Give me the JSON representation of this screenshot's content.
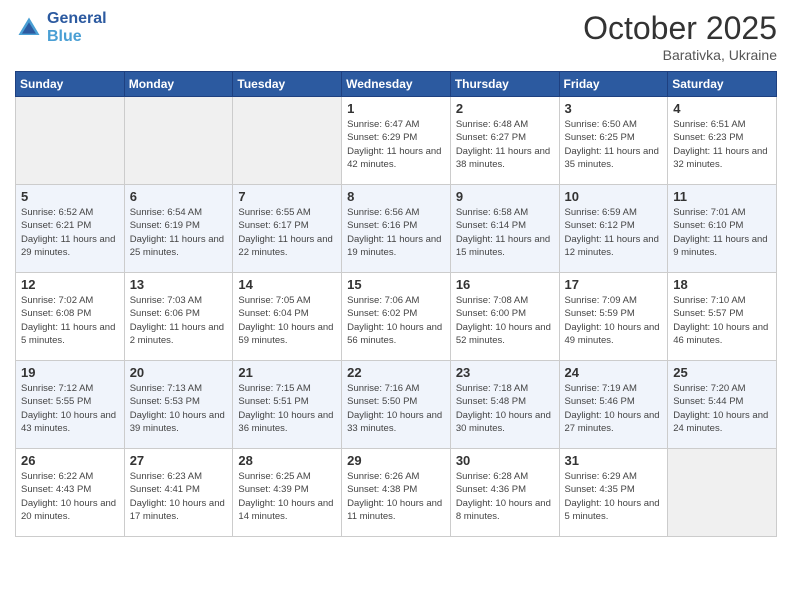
{
  "header": {
    "logo_line1": "General",
    "logo_line2": "Blue",
    "title": "October 2025",
    "subtitle": "Barativka, Ukraine"
  },
  "weekdays": [
    "Sunday",
    "Monday",
    "Tuesday",
    "Wednesday",
    "Thursday",
    "Friday",
    "Saturday"
  ],
  "weeks": [
    [
      {
        "day": "",
        "empty": true
      },
      {
        "day": "",
        "empty": true
      },
      {
        "day": "",
        "empty": true
      },
      {
        "day": "1",
        "sunrise": "6:47 AM",
        "sunset": "6:29 PM",
        "daylight": "11 hours and 42 minutes."
      },
      {
        "day": "2",
        "sunrise": "6:48 AM",
        "sunset": "6:27 PM",
        "daylight": "11 hours and 38 minutes."
      },
      {
        "day": "3",
        "sunrise": "6:50 AM",
        "sunset": "6:25 PM",
        "daylight": "11 hours and 35 minutes."
      },
      {
        "day": "4",
        "sunrise": "6:51 AM",
        "sunset": "6:23 PM",
        "daylight": "11 hours and 32 minutes."
      }
    ],
    [
      {
        "day": "5",
        "sunrise": "6:52 AM",
        "sunset": "6:21 PM",
        "daylight": "11 hours and 29 minutes."
      },
      {
        "day": "6",
        "sunrise": "6:54 AM",
        "sunset": "6:19 PM",
        "daylight": "11 hours and 25 minutes."
      },
      {
        "day": "7",
        "sunrise": "6:55 AM",
        "sunset": "6:17 PM",
        "daylight": "11 hours and 22 minutes."
      },
      {
        "day": "8",
        "sunrise": "6:56 AM",
        "sunset": "6:16 PM",
        "daylight": "11 hours and 19 minutes."
      },
      {
        "day": "9",
        "sunrise": "6:58 AM",
        "sunset": "6:14 PM",
        "daylight": "11 hours and 15 minutes."
      },
      {
        "day": "10",
        "sunrise": "6:59 AM",
        "sunset": "6:12 PM",
        "daylight": "11 hours and 12 minutes."
      },
      {
        "day": "11",
        "sunrise": "7:01 AM",
        "sunset": "6:10 PM",
        "daylight": "11 hours and 9 minutes."
      }
    ],
    [
      {
        "day": "12",
        "sunrise": "7:02 AM",
        "sunset": "6:08 PM",
        "daylight": "11 hours and 5 minutes."
      },
      {
        "day": "13",
        "sunrise": "7:03 AM",
        "sunset": "6:06 PM",
        "daylight": "11 hours and 2 minutes."
      },
      {
        "day": "14",
        "sunrise": "7:05 AM",
        "sunset": "6:04 PM",
        "daylight": "10 hours and 59 minutes."
      },
      {
        "day": "15",
        "sunrise": "7:06 AM",
        "sunset": "6:02 PM",
        "daylight": "10 hours and 56 minutes."
      },
      {
        "day": "16",
        "sunrise": "7:08 AM",
        "sunset": "6:00 PM",
        "daylight": "10 hours and 52 minutes."
      },
      {
        "day": "17",
        "sunrise": "7:09 AM",
        "sunset": "5:59 PM",
        "daylight": "10 hours and 49 minutes."
      },
      {
        "day": "18",
        "sunrise": "7:10 AM",
        "sunset": "5:57 PM",
        "daylight": "10 hours and 46 minutes."
      }
    ],
    [
      {
        "day": "19",
        "sunrise": "7:12 AM",
        "sunset": "5:55 PM",
        "daylight": "10 hours and 43 minutes."
      },
      {
        "day": "20",
        "sunrise": "7:13 AM",
        "sunset": "5:53 PM",
        "daylight": "10 hours and 39 minutes."
      },
      {
        "day": "21",
        "sunrise": "7:15 AM",
        "sunset": "5:51 PM",
        "daylight": "10 hours and 36 minutes."
      },
      {
        "day": "22",
        "sunrise": "7:16 AM",
        "sunset": "5:50 PM",
        "daylight": "10 hours and 33 minutes."
      },
      {
        "day": "23",
        "sunrise": "7:18 AM",
        "sunset": "5:48 PM",
        "daylight": "10 hours and 30 minutes."
      },
      {
        "day": "24",
        "sunrise": "7:19 AM",
        "sunset": "5:46 PM",
        "daylight": "10 hours and 27 minutes."
      },
      {
        "day": "25",
        "sunrise": "7:20 AM",
        "sunset": "5:44 PM",
        "daylight": "10 hours and 24 minutes."
      }
    ],
    [
      {
        "day": "26",
        "sunrise": "6:22 AM",
        "sunset": "4:43 PM",
        "daylight": "10 hours and 20 minutes."
      },
      {
        "day": "27",
        "sunrise": "6:23 AM",
        "sunset": "4:41 PM",
        "daylight": "10 hours and 17 minutes."
      },
      {
        "day": "28",
        "sunrise": "6:25 AM",
        "sunset": "4:39 PM",
        "daylight": "10 hours and 14 minutes."
      },
      {
        "day": "29",
        "sunrise": "6:26 AM",
        "sunset": "4:38 PM",
        "daylight": "10 hours and 11 minutes."
      },
      {
        "day": "30",
        "sunrise": "6:28 AM",
        "sunset": "4:36 PM",
        "daylight": "10 hours and 8 minutes."
      },
      {
        "day": "31",
        "sunrise": "6:29 AM",
        "sunset": "4:35 PM",
        "daylight": "10 hours and 5 minutes."
      },
      {
        "day": "",
        "empty": true
      }
    ]
  ]
}
